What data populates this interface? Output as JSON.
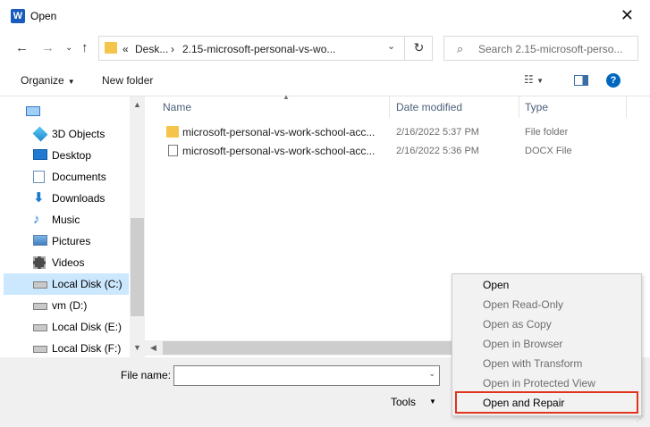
{
  "window": {
    "title": "Open",
    "app_icon_letter": "W"
  },
  "address_bar": {
    "segment_overflow": "«",
    "segment_1": "Desk...",
    "separator": "›",
    "segment_2": "2.15-microsoft-personal-vs-wo...",
    "dropdown_glyph": "⌄",
    "refresh_glyph": "↻"
  },
  "search": {
    "placeholder": "Search 2.15-microsoft-perso..."
  },
  "toolbar": {
    "organize_label": "Organize",
    "new_folder_label": "New folder"
  },
  "sidebar": {
    "items": [
      {
        "label": "",
        "icon": "this-pc-icon"
      },
      {
        "label": "3D Objects",
        "icon": "3d-objects-icon"
      },
      {
        "label": "Desktop",
        "icon": "desktop-icon"
      },
      {
        "label": "Documents",
        "icon": "documents-icon"
      },
      {
        "label": "Downloads",
        "icon": "downloads-icon"
      },
      {
        "label": "Music",
        "icon": "music-icon"
      },
      {
        "label": "Pictures",
        "icon": "pictures-icon"
      },
      {
        "label": "Videos",
        "icon": "videos-icon"
      },
      {
        "label": "Local Disk (C:)",
        "icon": "drive-icon",
        "selected": true
      },
      {
        "label": "vm (D:)",
        "icon": "drive-icon"
      },
      {
        "label": "Local Disk (E:)",
        "icon": "drive-icon"
      },
      {
        "label": "Local Disk (F:)",
        "icon": "drive-icon"
      }
    ]
  },
  "file_list": {
    "columns": {
      "name": "Name",
      "date": "Date modified",
      "type": "Type"
    },
    "rows": [
      {
        "name": "microsoft-personal-vs-work-school-acc...",
        "date": "2/16/2022 5:37 PM",
        "type": "File folder",
        "icon": "folder-icon"
      },
      {
        "name": "microsoft-personal-vs-work-school-acc...",
        "date": "2/16/2022 5:36 PM",
        "type": "DOCX File",
        "icon": "document-icon"
      }
    ]
  },
  "bottom": {
    "file_name_label": "File name:",
    "file_name_value": "",
    "tools_label": "Tools"
  },
  "open_menu": {
    "items": [
      {
        "label": "Open",
        "enabled": true
      },
      {
        "label": "Open Read-Only",
        "enabled": false
      },
      {
        "label": "Open as Copy",
        "enabled": false
      },
      {
        "label": "Open in Browser",
        "enabled": false
      },
      {
        "label": "Open with Transform",
        "enabled": false
      },
      {
        "label": "Open in Protected View",
        "enabled": false
      },
      {
        "label": "Open and Repair",
        "enabled": true,
        "highlighted": true
      }
    ]
  },
  "colors": {
    "accent": "#0067c0",
    "highlight_border": "#e0341c",
    "selection": "#cce8ff",
    "folder": "#f5c54b"
  }
}
